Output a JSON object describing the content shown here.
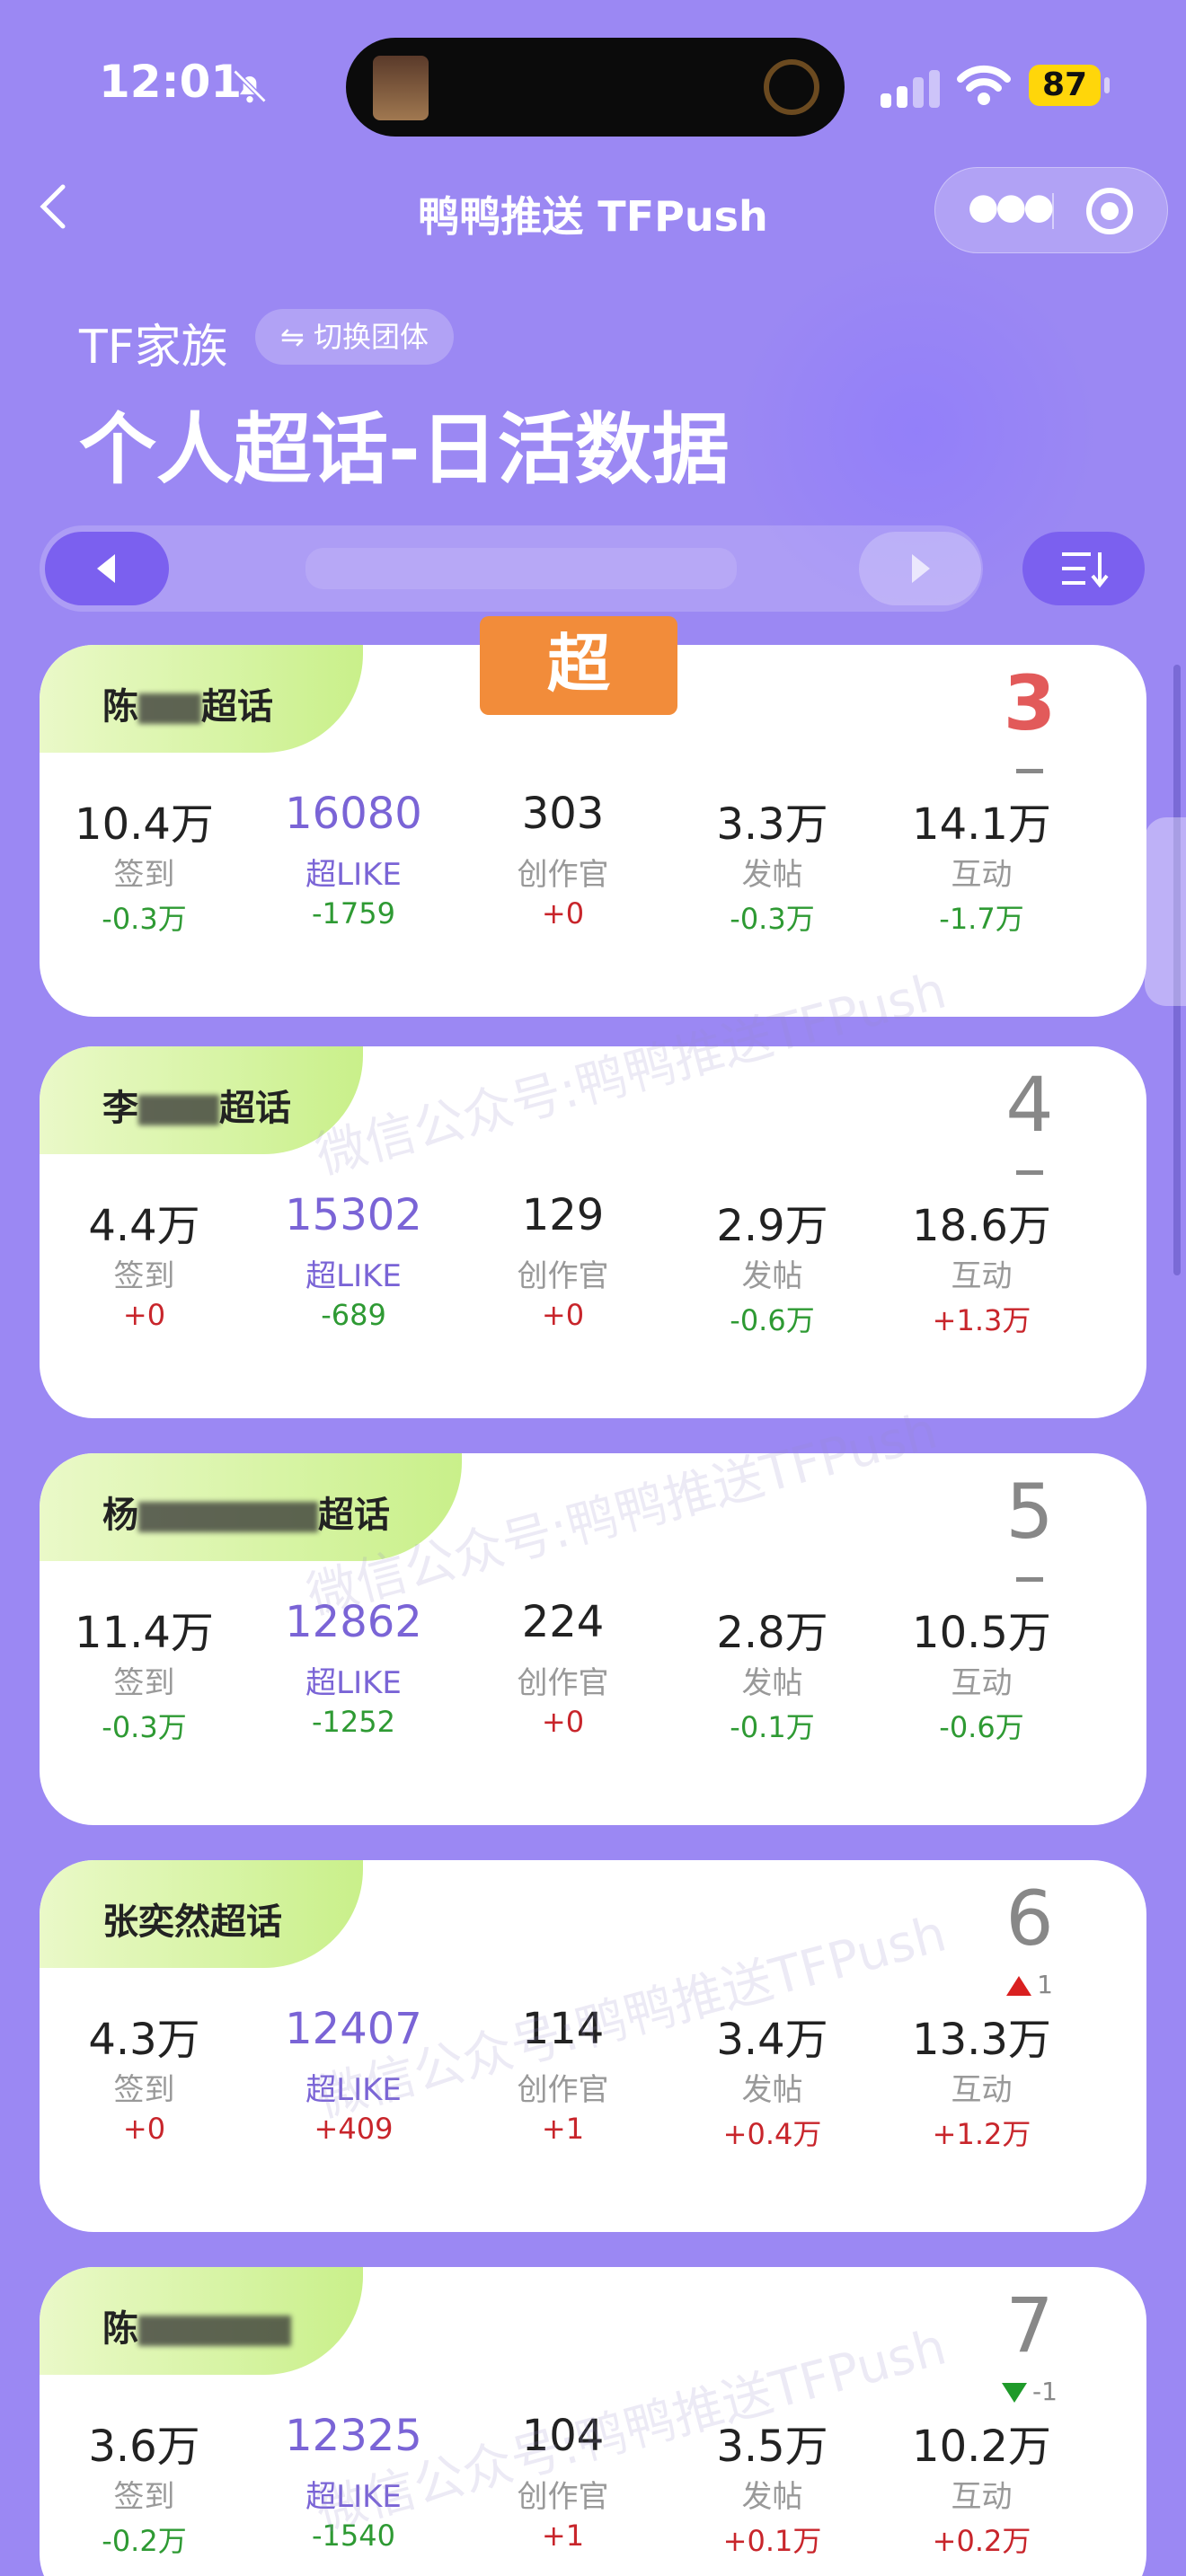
{
  "status_bar": {
    "time": "12:01",
    "battery": "87"
  },
  "nav": {
    "title": "鸭鸭推送 TFPush"
  },
  "header": {
    "family": "TF家族",
    "switch_label": "⇋ 切换团体",
    "title": "个人超话-日活数据"
  },
  "sticker": "超 like",
  "watermark": "微信公众号:鸭鸭推送TFPush",
  "cards": [
    {
      "name": "陈",
      "name_suffix": "超话",
      "rank": "3",
      "rank_change": "",
      "stats": [
        {
          "value": "10.4万",
          "label": "签到",
          "delta": "-0.3万"
        },
        {
          "value": "16080",
          "label": "超LIKE",
          "delta": "-1759"
        },
        {
          "value": "303",
          "label": "创作官",
          "delta": "+0"
        },
        {
          "value": "3.3万",
          "label": "发帖",
          "delta": "-0.3万"
        },
        {
          "value": "14.1万",
          "label": "互动",
          "delta": "-1.7万"
        }
      ]
    },
    {
      "name": "李",
      "name_suffix": "超话",
      "rank": "4",
      "rank_change": "",
      "stats": [
        {
          "value": "4.4万",
          "label": "签到",
          "delta": "+0"
        },
        {
          "value": "15302",
          "label": "超LIKE",
          "delta": "-689"
        },
        {
          "value": "129",
          "label": "创作官",
          "delta": "+0"
        },
        {
          "value": "2.9万",
          "label": "发帖",
          "delta": "-0.6万"
        },
        {
          "value": "18.6万",
          "label": "互动",
          "delta": "+1.3万"
        }
      ]
    },
    {
      "name": "杨",
      "name_suffix": "超话",
      "rank": "5",
      "rank_change": "",
      "stats": [
        {
          "value": "11.4万",
          "label": "签到",
          "delta": "-0.3万"
        },
        {
          "value": "12862",
          "label": "超LIKE",
          "delta": "-1252"
        },
        {
          "value": "224",
          "label": "创作官",
          "delta": "+0"
        },
        {
          "value": "2.8万",
          "label": "发帖",
          "delta": "-0.1万"
        },
        {
          "value": "10.5万",
          "label": "互动",
          "delta": "-0.6万"
        }
      ]
    },
    {
      "name": "张奕然超话",
      "name_suffix": "",
      "rank": "6",
      "rank_change": "1",
      "stats": [
        {
          "value": "4.3万",
          "label": "签到",
          "delta": "+0"
        },
        {
          "value": "12407",
          "label": "超LIKE",
          "delta": "+409"
        },
        {
          "value": "114",
          "label": "创作官",
          "delta": "+1"
        },
        {
          "value": "3.4万",
          "label": "发帖",
          "delta": "+0.4万"
        },
        {
          "value": "13.3万",
          "label": "互动",
          "delta": "+1.2万"
        }
      ]
    },
    {
      "name": "陈",
      "name_suffix": "",
      "rank": "7",
      "rank_change": "-1",
      "stats": [
        {
          "value": "3.6万",
          "label": "签到",
          "delta": "-0.2万"
        },
        {
          "value": "12325",
          "label": "超LIKE",
          "delta": "-1540"
        },
        {
          "value": "104",
          "label": "创作官",
          "delta": "+1"
        },
        {
          "value": "3.5万",
          "label": "发帖",
          "delta": "+0.1万"
        },
        {
          "value": "10.2万",
          "label": "互动",
          "delta": "+0.2万"
        }
      ]
    }
  ],
  "colors": {
    "background": "#9b88f3",
    "accent": "#7b60ef",
    "positive_delta": "#c8252b",
    "negative_delta": "#2e9a33",
    "top_rank": "#e25a5a"
  }
}
